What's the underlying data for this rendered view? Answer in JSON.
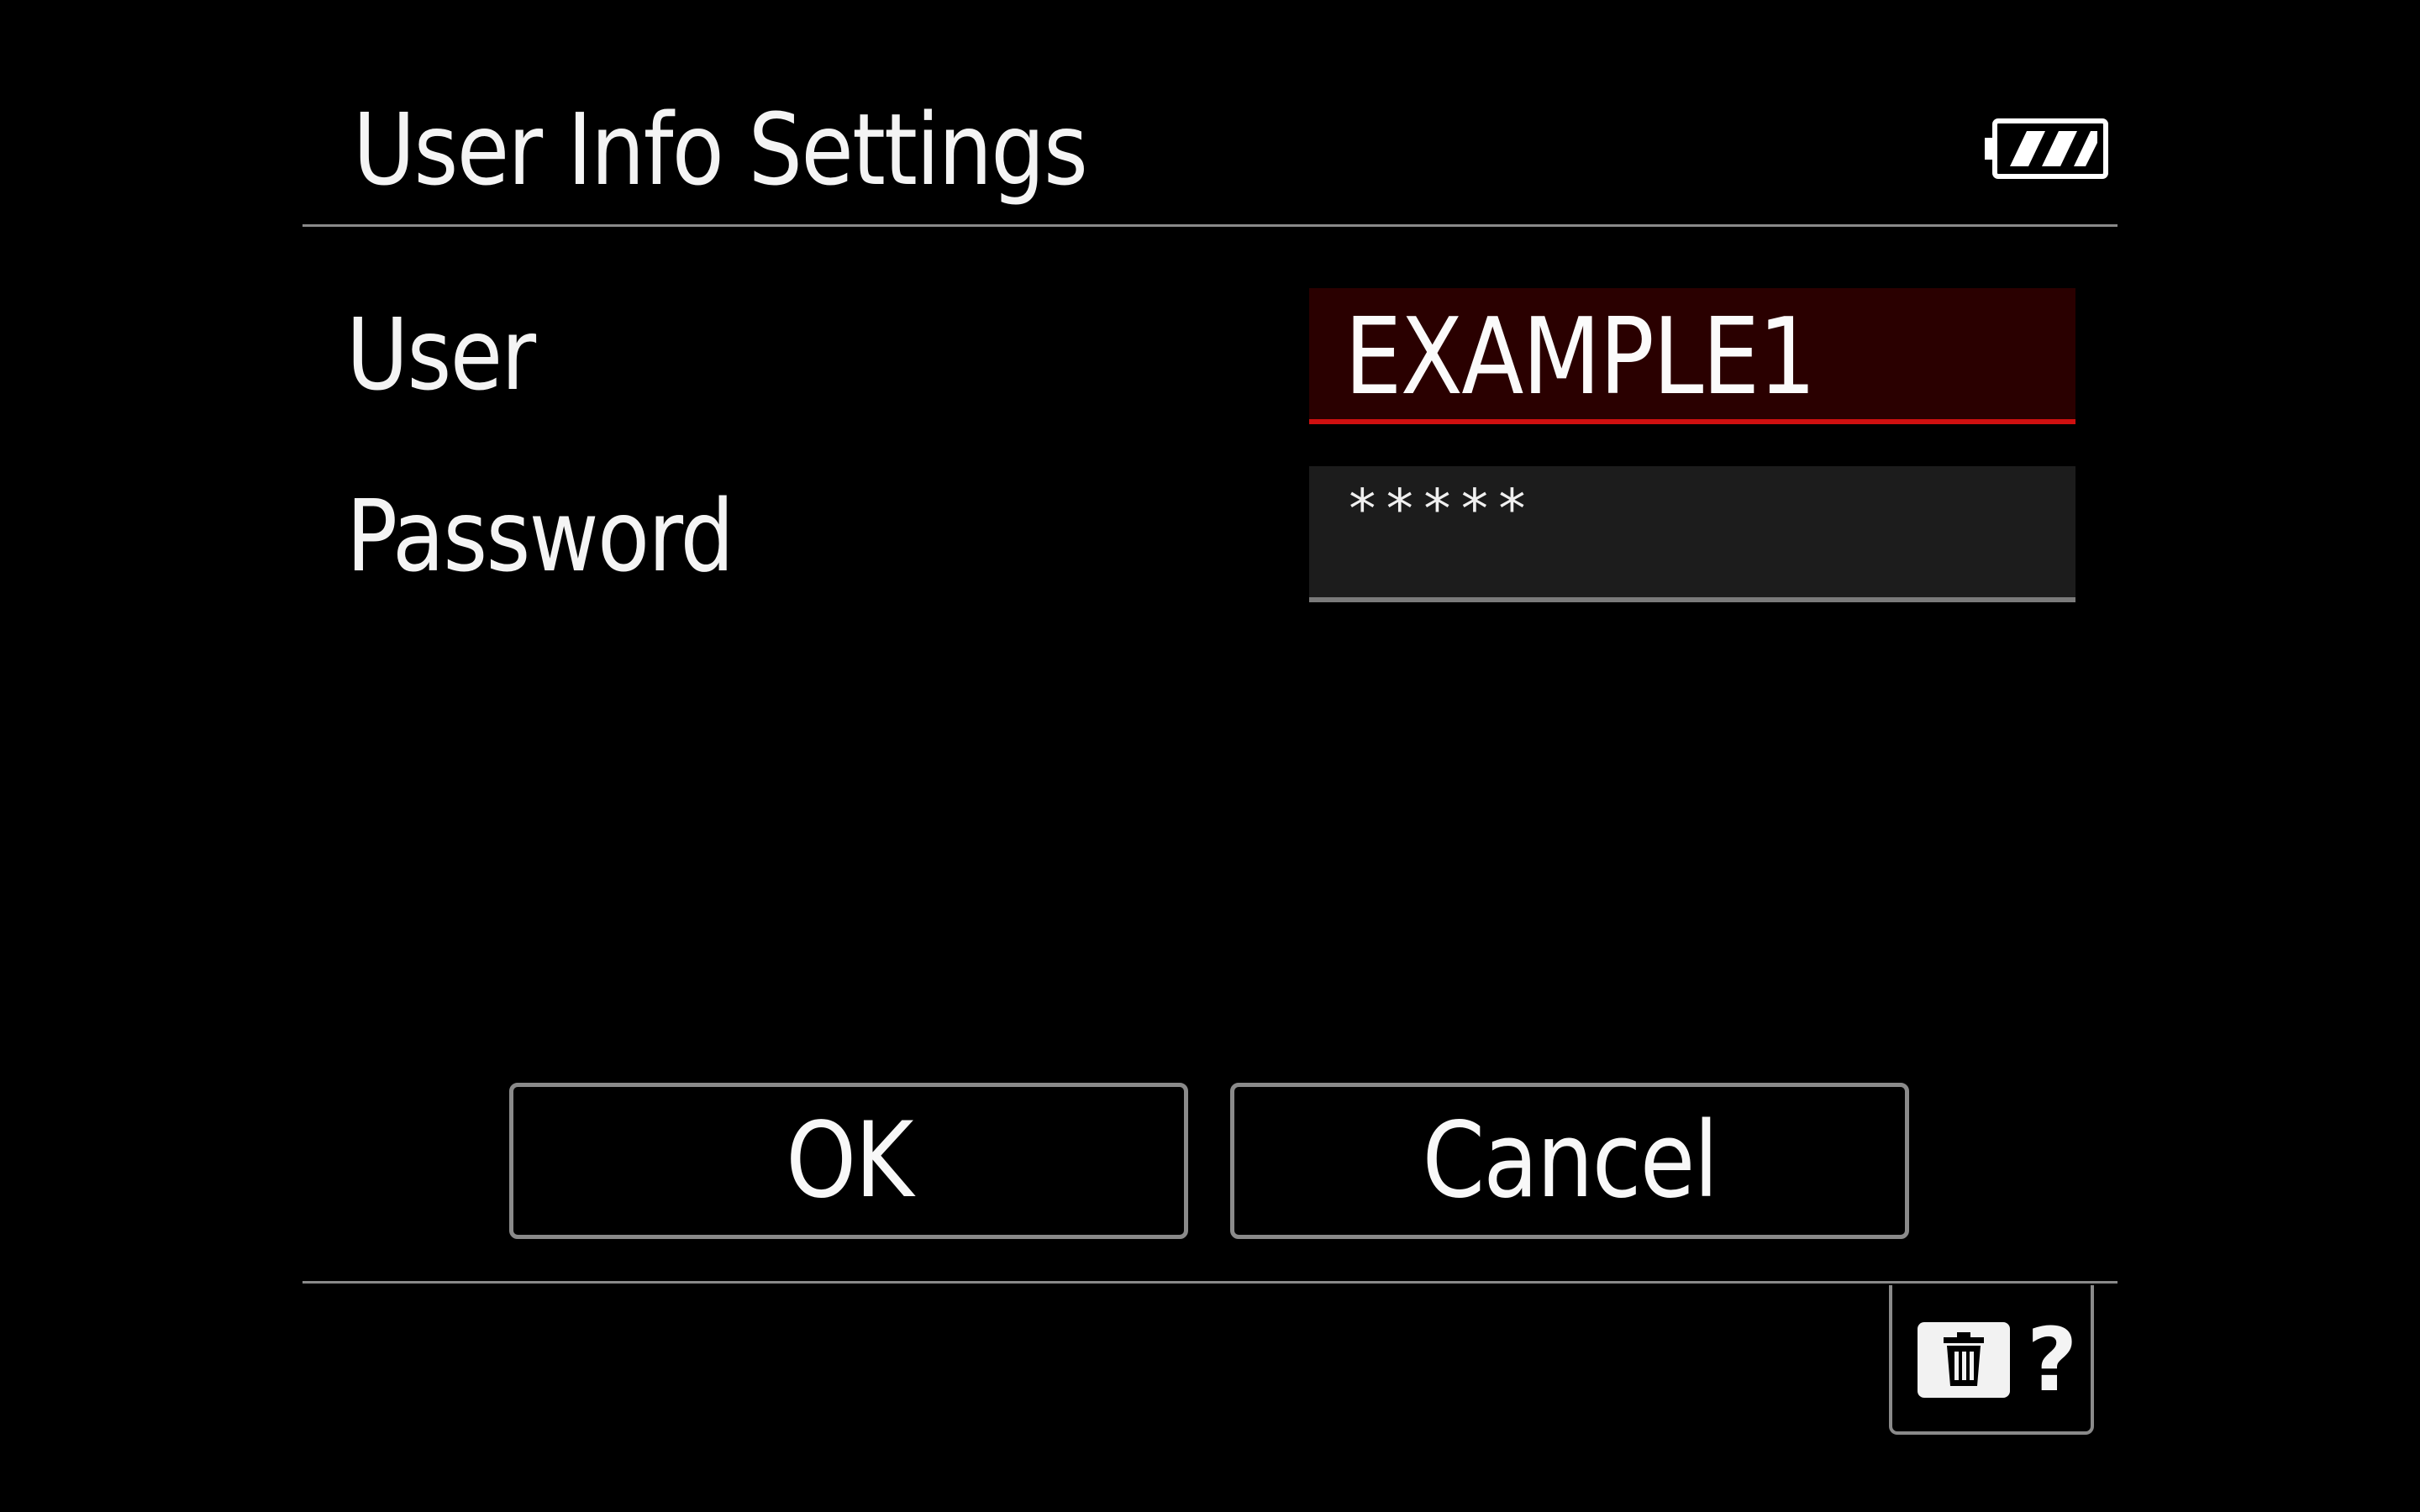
{
  "header": {
    "title": "User Info Settings",
    "battery_icon": "battery-full-icon"
  },
  "form": {
    "user_label": "User",
    "user_value": "EXAMPLE1",
    "password_label": "Password",
    "password_value": "*****"
  },
  "buttons": {
    "ok_label": "OK",
    "cancel_label": "Cancel"
  },
  "help": {
    "delete_icon": "trash-icon",
    "help_label": "?"
  },
  "colors": {
    "background": "#000000",
    "focused_field_bg": "#2a0000",
    "focus_underline": "#d01010",
    "text": "#ffffff"
  }
}
